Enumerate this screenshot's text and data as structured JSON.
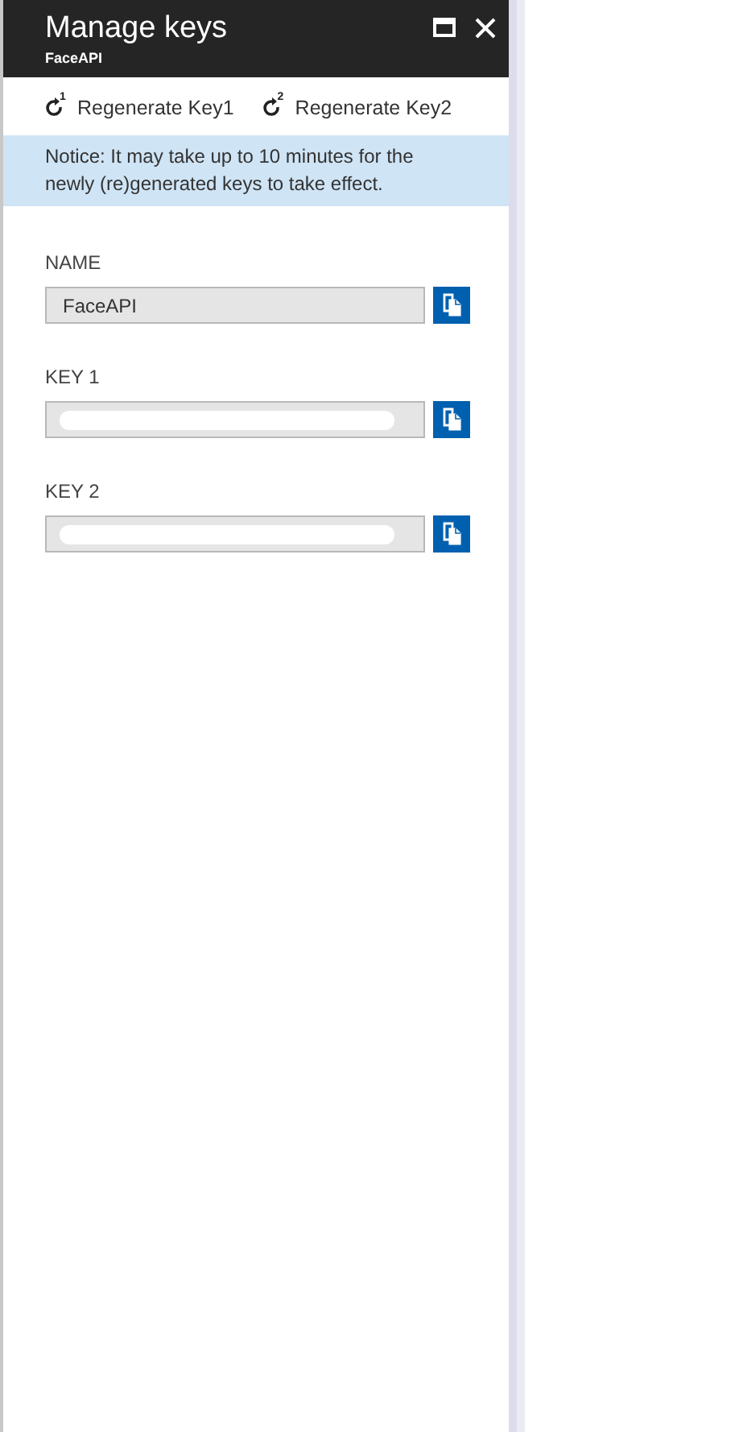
{
  "window": {
    "title": "Manage keys",
    "subtitle": "FaceAPI"
  },
  "toolbar": [
    {
      "label": "Regenerate Key1",
      "badge": "1"
    },
    {
      "label": "Regenerate Key2",
      "badge": "2"
    }
  ],
  "notice": "Notice: It may take up to 10 minutes for the newly (re)generated keys to take effect.",
  "fields": [
    {
      "label": "NAME",
      "value": "FaceAPI",
      "redacted": false
    },
    {
      "label": "KEY 1",
      "redacted": true
    },
    {
      "label": "KEY 2",
      "redacted": true
    }
  ]
}
